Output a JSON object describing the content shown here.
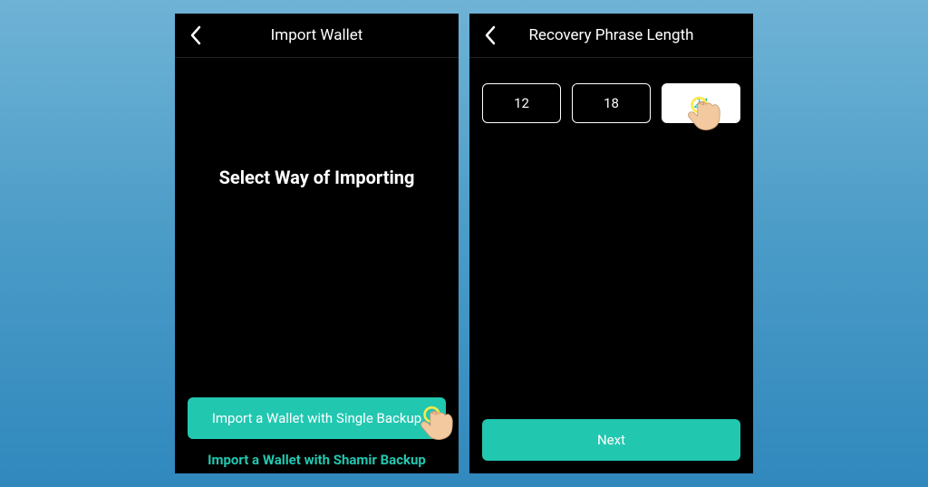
{
  "screen1": {
    "header": {
      "title": "Import Wallet"
    },
    "prompt": "Select Way of Importing",
    "primary_button": "Import a Wallet with Single Backup",
    "secondary_link": "Import a Wallet with Shamir Backup"
  },
  "screen2": {
    "header": {
      "title": "Recovery Phrase Length"
    },
    "options": {
      "a": "12",
      "b": "18",
      "c": "24"
    },
    "selected": "24",
    "next_button": "Next"
  },
  "colors": {
    "accent": "#22c7b0",
    "bg": "#000000",
    "gradient_top": "#6fb3d6",
    "gradient_bottom": "#3088bd"
  }
}
